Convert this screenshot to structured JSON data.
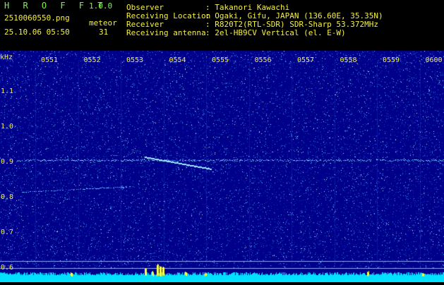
{
  "app": {
    "name": "H R O F F T",
    "version": "1.0.0"
  },
  "file": {
    "name": "2510060550.png",
    "datetime": "25.10.06 05:50"
  },
  "detection": {
    "label": "meteor",
    "count": "31"
  },
  "info": {
    "observer_label": "Observer",
    "observer_value": ": Takanori Kawachi",
    "location_label": "Receiving Location",
    "location_value": ": Ogaki, Gifu, JAPAN (136.60E, 35.35N)",
    "receiver_label": "Receiver",
    "receiver_value": ": R820T2(RTL-SDR) SDR-Sharp 53.372MHz",
    "antenna_label": "Receiving antenna",
    "antenna_value": ": 2el-HB9CV Vertical (el. E-W)"
  },
  "axis": {
    "y_unit": "kHz",
    "y_ticks": [
      "1.1",
      "1.0",
      "0.9",
      "0.8",
      "0.7",
      "0.6"
    ],
    "x_ticks": [
      "0551",
      "0552",
      "0553",
      "0554",
      "0555",
      "0556",
      "0557",
      "0558",
      "0559",
      "0600"
    ]
  },
  "colors": {
    "background": "#00008a",
    "noise": "#4aa6ff",
    "trace": "#9ee8ff",
    "label_green": "#7cf24e",
    "label_yellow": "#f5f044",
    "baseline": "#00e0ff",
    "burst": "#ffff40"
  }
}
